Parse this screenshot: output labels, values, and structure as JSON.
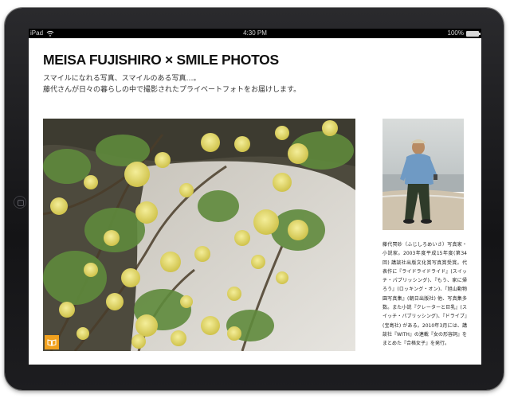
{
  "status_bar": {
    "carrier": "iPad",
    "time": "4:30 PM",
    "battery": "100%"
  },
  "page": {
    "title": "MEISA FUJISHIRO × SMILE PHOTOS",
    "subtitle_line1": "スマイルになれる写真、スマイルのある写真…。",
    "subtitle_line2": "藤代さんが日々の暮らしの中で撮影されたプライベートフォトをお届けします。"
  },
  "profile": {
    "bio": "藤代冥砂（ふじしろめいさ）写真家・小説家。2003年度平成15年度(第34回) 講談社出版文化賞写真賞受賞。代表作に『ライドライドライド』(スイッチ・パブリッシング)、『もう、家に帰ろう』(ロッキング・オン)、『旭山動物園写真集』(朝日出版社) 他、写真集多数。また小説『クレーターと巨乳』(スイッチ・パブリッシング)、『ドライブ』(宝島社) がある。2010年3月には、講談社『WITH』の連載『女の形容詞』をまとめた『合格女子』を発行。"
  },
  "icons": {
    "gallery": "book-icon",
    "wifi": "wifi-icon",
    "battery": "battery-icon"
  },
  "colors": {
    "accent": "#f1a11e",
    "bezel": "#1a1a1c"
  }
}
